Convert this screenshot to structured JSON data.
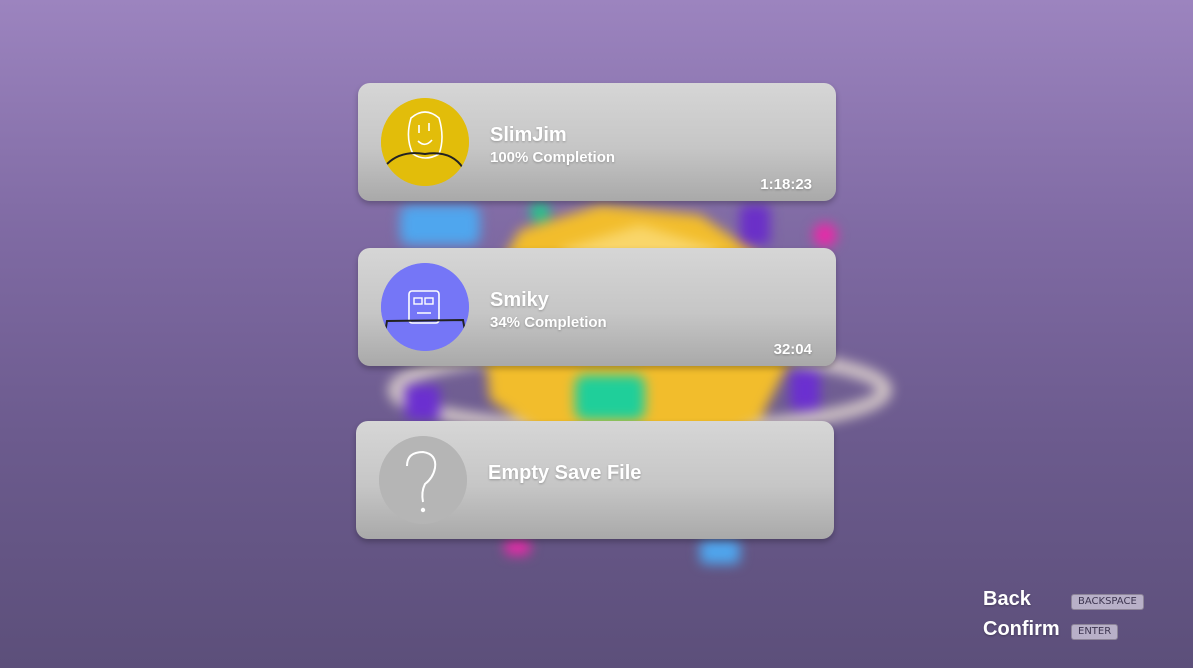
{
  "save_slots": [
    {
      "name": "SlimJim",
      "completion": "100% Completion",
      "time": "1:18:23",
      "avatar_color": "#e2bd0a",
      "avatar_icon": "smiley-face-icon"
    },
    {
      "name": "Smiky",
      "completion": "34% Completion",
      "time": "32:04",
      "avatar_color": "#7576f7",
      "avatar_icon": "robot-face-icon"
    },
    {
      "label": "Empty Save File",
      "avatar_color": "#b5b5b5",
      "avatar_icon": "question-mark-icon"
    }
  ],
  "controls": [
    {
      "label": "Back",
      "key": "BACKSPACE"
    },
    {
      "label": "Confirm",
      "key": "ENTER"
    }
  ],
  "colors": {
    "background_top": "#9c84bf",
    "background_bottom": "#5c4f7a",
    "card": "#c9c9c9"
  }
}
